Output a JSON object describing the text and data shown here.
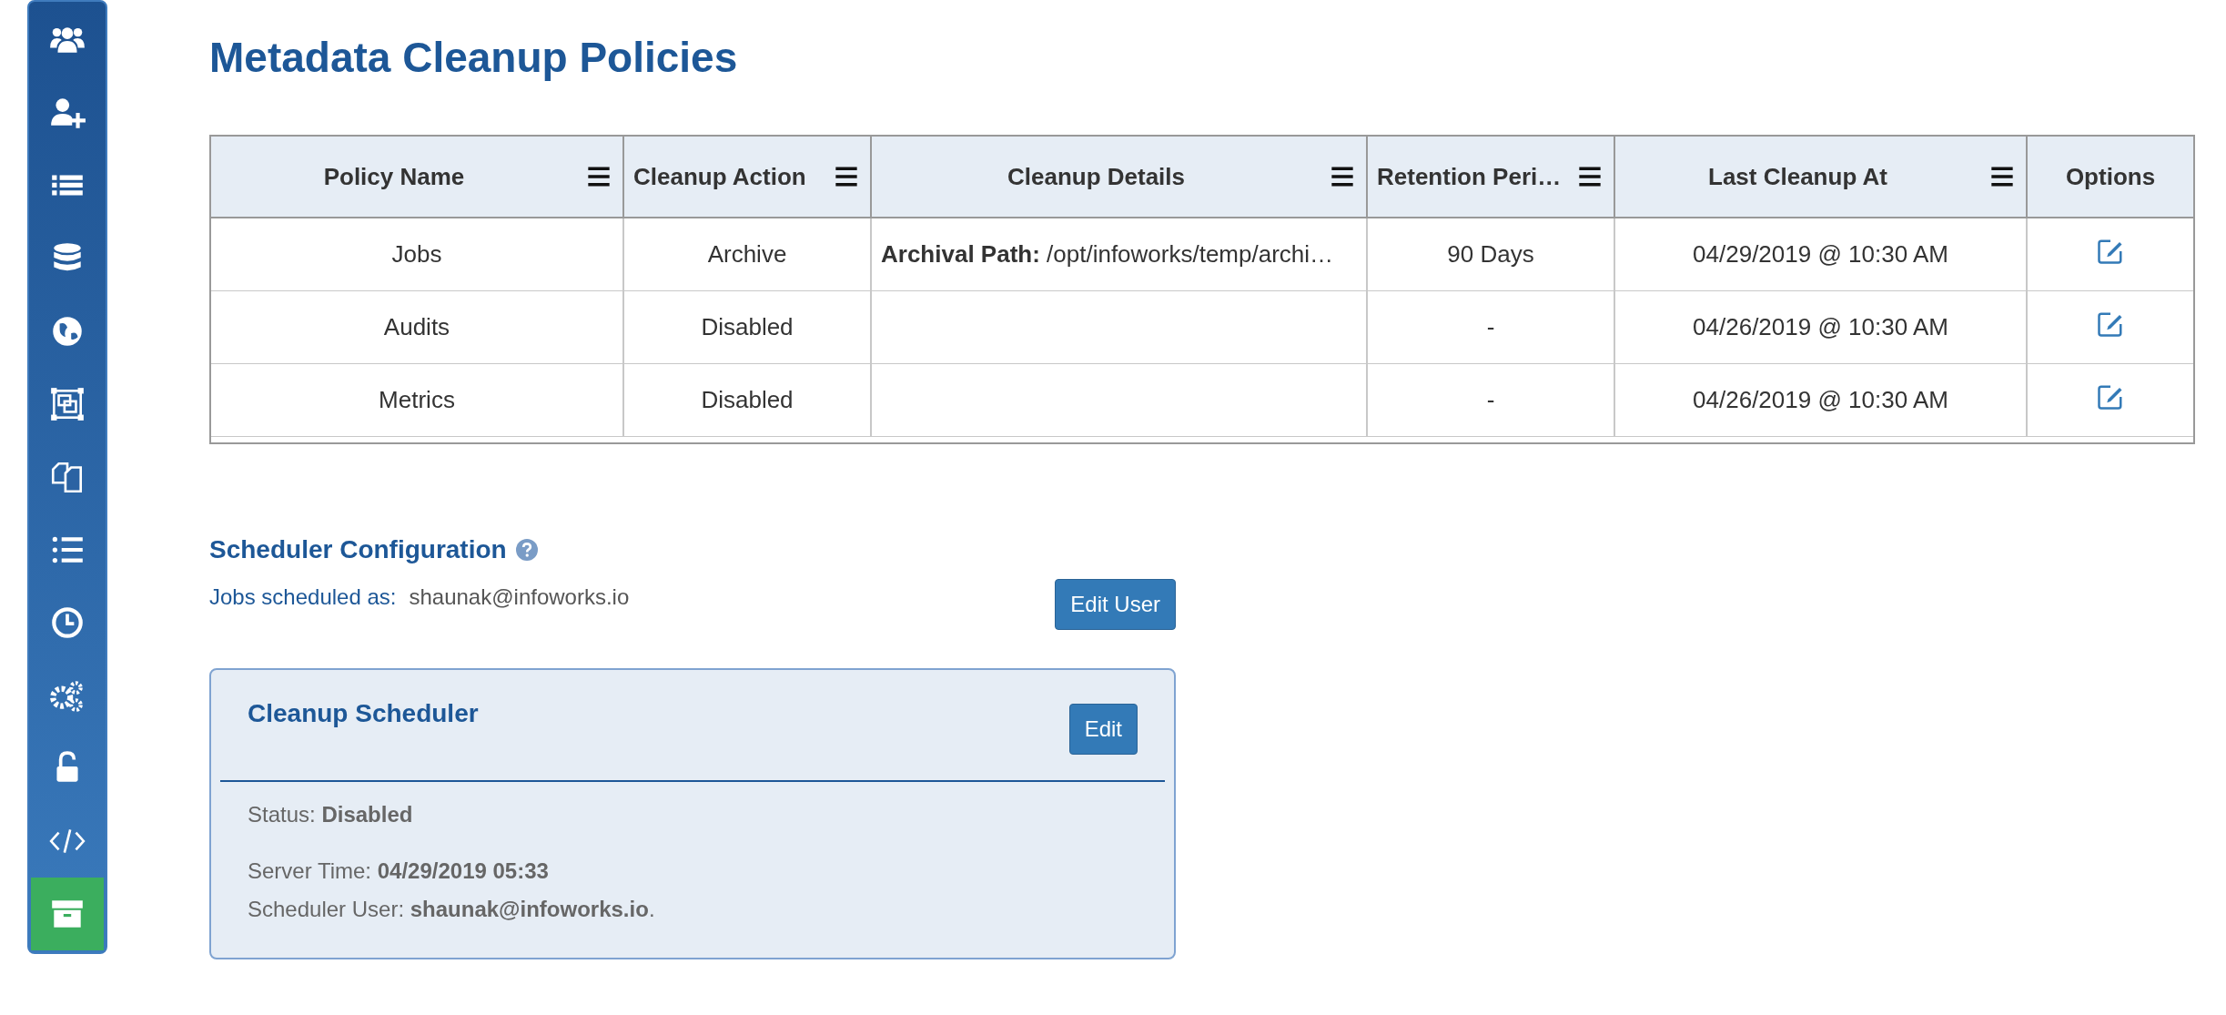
{
  "sidebar": {
    "items": [
      {
        "selected": false
      },
      {
        "selected": false
      },
      {
        "selected": false
      },
      {
        "selected": false
      },
      {
        "selected": false
      },
      {
        "selected": false
      },
      {
        "selected": false
      },
      {
        "selected": false
      },
      {
        "selected": false
      },
      {
        "selected": false
      },
      {
        "selected": false
      },
      {
        "selected": false
      },
      {
        "selected": true
      }
    ]
  },
  "page_title": "Metadata Cleanup Policies",
  "table": {
    "columns": [
      {
        "label": "Policy Name",
        "menu": true
      },
      {
        "label": "Cleanup Action",
        "menu": true
      },
      {
        "label": "Cleanup Details",
        "menu": true
      },
      {
        "label": "Retention Peri…",
        "menu": true
      },
      {
        "label": "Last Cleanup At",
        "menu": true
      },
      {
        "label": "Options",
        "menu": false
      }
    ],
    "rows": [
      {
        "policy_name": "Jobs",
        "cleanup_action": "Archive",
        "cleanup_details": "**Archival Path:** /opt/infoworks/temp/archi…",
        "retention_period": "90 Days",
        "last_cleanup_at": "04/29/2019 @ 10:30 AM"
      },
      {
        "policy_name": "Audits",
        "cleanup_action": "Disabled",
        "retention_period": "-",
        "last_cleanup_at": "04/26/2019 @ 10:30 AM"
      },
      {
        "policy_name": "Metrics",
        "cleanup_action": "Disabled",
        "retention_period": "-",
        "last_cleanup_at": "04/26/2019 @ 10:30 AM"
      }
    ]
  },
  "scheduler_configuration": {
    "title": "Scheduler Configuration",
    "jobs_label": "Jobs scheduled as:",
    "jobs_user": "shaunak@infoworks.io",
    "edit_user_button": "Edit User"
  },
  "cleanup_scheduler": {
    "title": "Cleanup Scheduler",
    "edit_button": "Edit",
    "status": "Status: **Disabled**",
    "server_time": "Server Time:  **04/29/2019 05:33**",
    "scheduler_user": "Scheduler User:  **shaunak@infoworks.io**."
  }
}
